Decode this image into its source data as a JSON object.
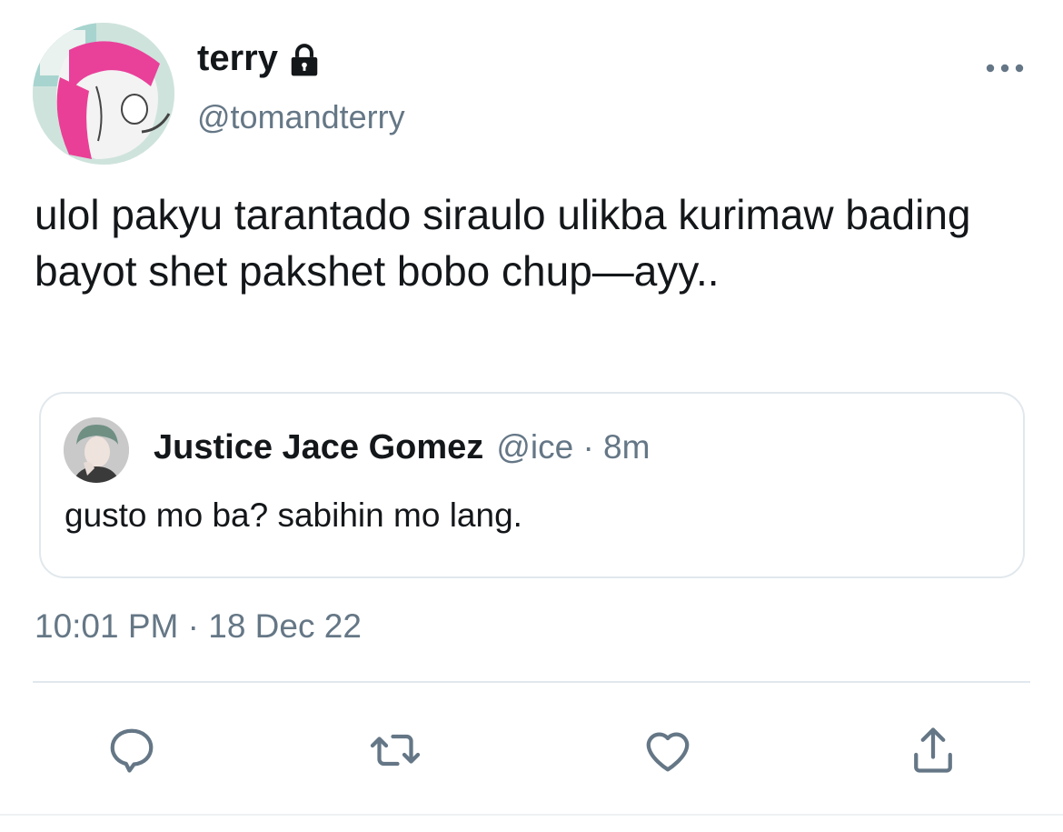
{
  "author": {
    "display_name": "terry",
    "handle": "@tomandterry",
    "protected": true
  },
  "tweet": {
    "text": "ulol pakyu tarantado siraulo ulikba kurimaw bading bayot shet pakshet bobo chup—ayy..",
    "timestamp": "10:01 PM · 18 Dec 22"
  },
  "quoted_tweet": {
    "author_name": "Justice Jace Gomez",
    "meta": "@ice · 8m",
    "text": "gusto mo ba? sabihin mo lang."
  },
  "icons": {
    "lock": "lock-icon",
    "more": "more-horizontal-icon",
    "reply": "reply-icon",
    "retweet": "retweet-icon",
    "like": "heart-icon",
    "share": "share-icon"
  },
  "colors": {
    "text_primary": "#14171a",
    "text_secondary": "#657786",
    "border": "#e1e8ed"
  }
}
